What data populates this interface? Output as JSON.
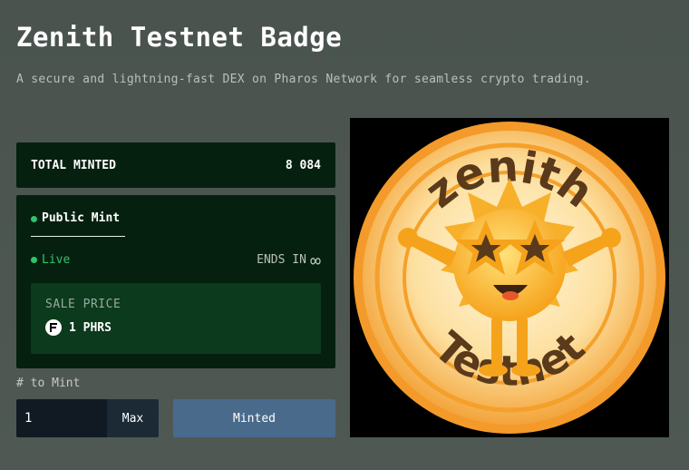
{
  "header": {
    "title": "Zenith Testnet Badge",
    "subtitle": "A secure and lightning-fast DEX on Pharos Network for seamless crypto trading."
  },
  "stats": {
    "total_minted_label": "TOTAL MINTED",
    "total_minted_value": "8 084"
  },
  "mint_phase": {
    "tab_label": "Public Mint",
    "status": "Live",
    "ends_in_label": "ENDS IN",
    "ends_in_value": "∞",
    "sale_price_label": "SALE PRICE",
    "sale_price_value": "1 PHRS",
    "token_icon": "pharos-token-icon"
  },
  "mint_form": {
    "quantity_label": "# to Mint",
    "quantity_value": "1",
    "max_label": "Max",
    "submit_label": "Minted"
  },
  "badge": {
    "top_text": "zenith",
    "bottom_text": "Testnet"
  },
  "colors": {
    "page_bg": "#4a534e",
    "card_bg": "#06200f",
    "price_bg": "#0b3a1c",
    "accent_green": "#2ec46b",
    "button_blue": "#4a6a8c",
    "badge_orange": "#f5a623"
  }
}
